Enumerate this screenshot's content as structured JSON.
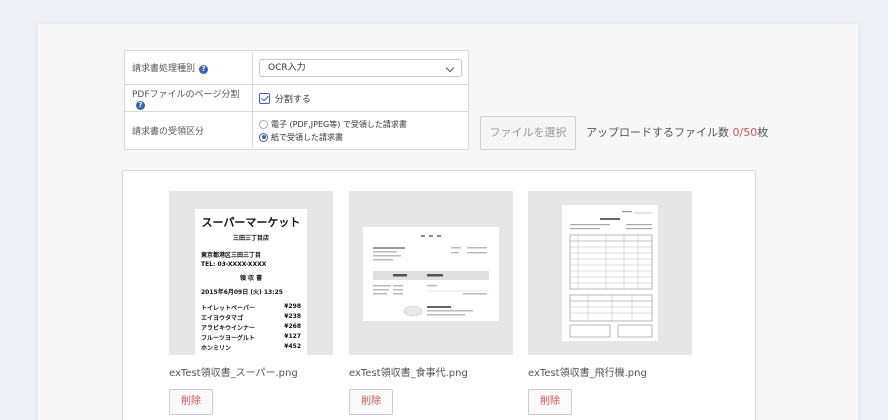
{
  "settings": {
    "type_label": "請求書処理種別",
    "type_value": "OCR入力",
    "split_label": "PDFファイルのページ分割",
    "split_checkbox_label": "分割する",
    "receive_label": "請求書の受領区分",
    "receive_options": [
      "電子 (PDF,JPEG等) で受領した請求書",
      "紙で受領した請求書"
    ],
    "help_glyph": "?"
  },
  "upload": {
    "button_label": "ファイルを選択",
    "count_prefix": "アップロードするファイル数 ",
    "count_current": "0",
    "count_separator": "/",
    "count_max": "50",
    "count_suffix": "枚",
    "accent_color": "#d9534f"
  },
  "receipt_super": {
    "title": "スーパーマーケット",
    "store": "三田三丁目店",
    "address": "東京都港区三田三丁目",
    "tel": "TEL: 03-XXXX-XXXX",
    "heading": "領 収 書",
    "date": "2015年6月09日 (火) 13:25",
    "items": [
      {
        "name": "トイレットペーパー",
        "price": "¥298"
      },
      {
        "name": "エイヨウタマゴ",
        "price": "¥238"
      },
      {
        "name": "アラビキウインナー",
        "price": "¥268"
      },
      {
        "name": "フルーツヨーグルト",
        "price": "¥127"
      },
      {
        "name": "ホンミリン",
        "price": "¥452"
      }
    ]
  },
  "files": [
    {
      "name": "exTest領収書_スーパー.png",
      "delete_label": "削除"
    },
    {
      "name": "exTest領収書_食事代.png",
      "delete_label": "削除"
    },
    {
      "name": "exTest領収書_飛行機.png",
      "delete_label": "削除"
    }
  ]
}
